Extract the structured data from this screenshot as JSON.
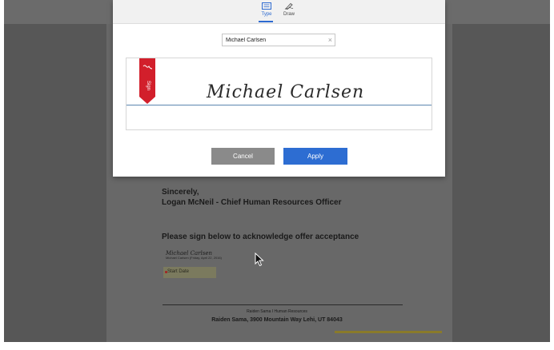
{
  "dialog": {
    "tabs": [
      {
        "label": "Type",
        "icon": "keyboard-icon",
        "active": true
      },
      {
        "label": "Draw",
        "icon": "pen-draw-icon",
        "active": false
      }
    ],
    "name_value": "Michael Carlsen",
    "signature_preview": "Michael Carlsen",
    "sign_flag_label": "Sign",
    "cancel_label": "Cancel",
    "apply_label": "Apply"
  },
  "document": {
    "closing_1": "Sincerely,",
    "closing_2": "Logan McNeil - Chief Human Resources Officer",
    "acknowledge": "Please sign below to acknowledge offer acceptance",
    "mini_signature": "Michael Carlsen",
    "mini_signature_meta": "Michael Carlsen  (Friday, April 22, 2016)",
    "start_date_label": "Start Date",
    "footer_line_1": "Raiden Sama I Human Resources",
    "footer_line_2": "Raiden Sama, 3900 Mountain Way Lehi, UT 84043"
  },
  "colors": {
    "accent": "#2d6dd2",
    "sign_flag": "#d21f2b",
    "overlay": "#575757"
  }
}
